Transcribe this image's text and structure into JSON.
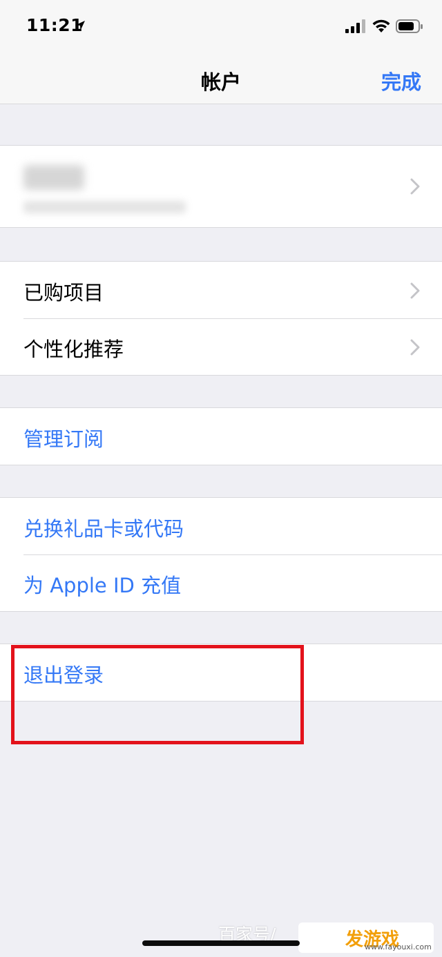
{
  "status_bar": {
    "time": "11:21"
  },
  "nav": {
    "title": "帐户",
    "done_label": "完成"
  },
  "account_group": {
    "name_blurred": true
  },
  "store_group": {
    "items": [
      {
        "label": "已购项目"
      },
      {
        "label": "个性化推荐"
      }
    ]
  },
  "subscriptions": {
    "label": "管理订阅"
  },
  "funds_group": {
    "items": [
      {
        "label": "兑换礼品卡或代码"
      },
      {
        "label": "为 Apple ID 充值"
      }
    ]
  },
  "sign_out": {
    "label": "退出登录"
  },
  "watermark": {
    "text": "百家号/",
    "logo_text": "发游戏",
    "logo_url": "www.fayouxi.com"
  },
  "colors": {
    "link": "#3478f6",
    "highlight_box": "#e3121b",
    "background": "#efeff4"
  }
}
